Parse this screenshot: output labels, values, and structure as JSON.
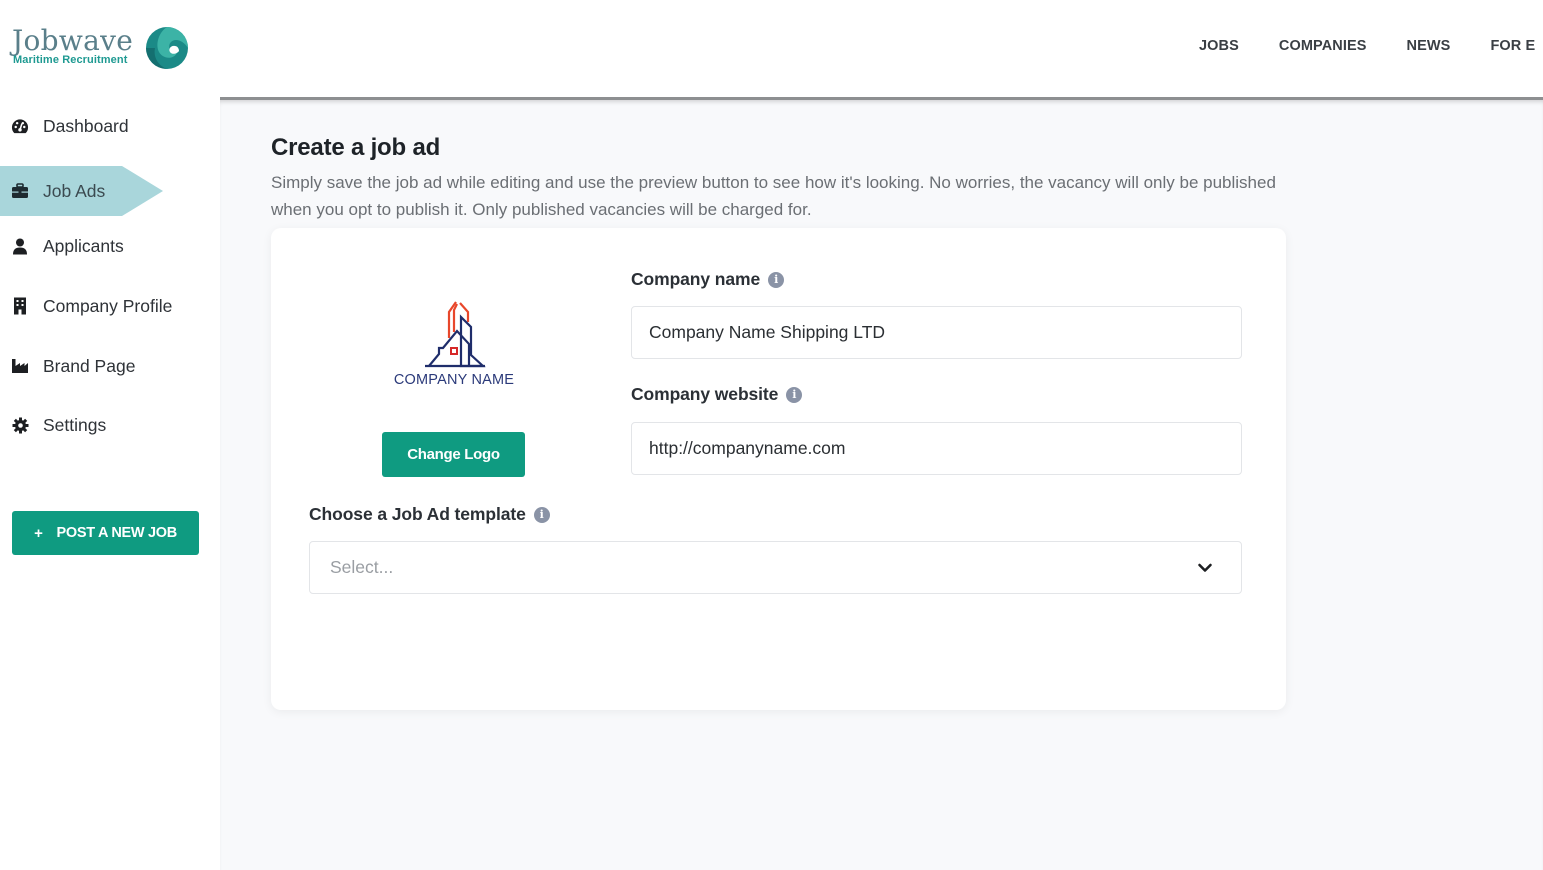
{
  "brand": {
    "name": "Jobwave",
    "tagline": "Maritime Recruitment",
    "colors": {
      "primary_green": "#0f9b81",
      "active_nav_bg": "#a9d6db",
      "wave_teal": "#1f8f8c"
    }
  },
  "topnav": {
    "items": [
      {
        "label": "JOBS"
      },
      {
        "label": "COMPANIES"
      },
      {
        "label": "NEWS"
      },
      {
        "label": "FOR E"
      }
    ]
  },
  "sidebar": {
    "items": [
      {
        "label": "Dashboard",
        "icon": "tachometer-icon",
        "active": false
      },
      {
        "label": "Job Ads",
        "icon": "briefcase-icon",
        "active": true
      },
      {
        "label": "Applicants",
        "icon": "user-icon",
        "active": false
      },
      {
        "label": "Company Profile",
        "icon": "building-icon",
        "active": false
      },
      {
        "label": "Brand Page",
        "icon": "industry-icon",
        "active": false
      },
      {
        "label": "Settings",
        "icon": "gear-icon",
        "active": false
      }
    ],
    "post_button": {
      "icon": "+",
      "label": "POST A NEW JOB"
    }
  },
  "page": {
    "title": "Create a job ad",
    "description": "Simply save the job ad while editing and use the preview button to see how it's looking. No worries, the vacancy will only be published when you opt to publish it. Only published vacancies will be charged for."
  },
  "form": {
    "logo": {
      "text": "COMPANY NAME",
      "change_button": "Change Logo"
    },
    "company_name": {
      "label": "Company name",
      "value": "Company Name Shipping LTD"
    },
    "company_website": {
      "label": "Company website",
      "value": "http://companyname.com"
    },
    "template": {
      "label": "Choose a Job Ad template",
      "placeholder": "Select..."
    },
    "info_glyph": "i"
  }
}
